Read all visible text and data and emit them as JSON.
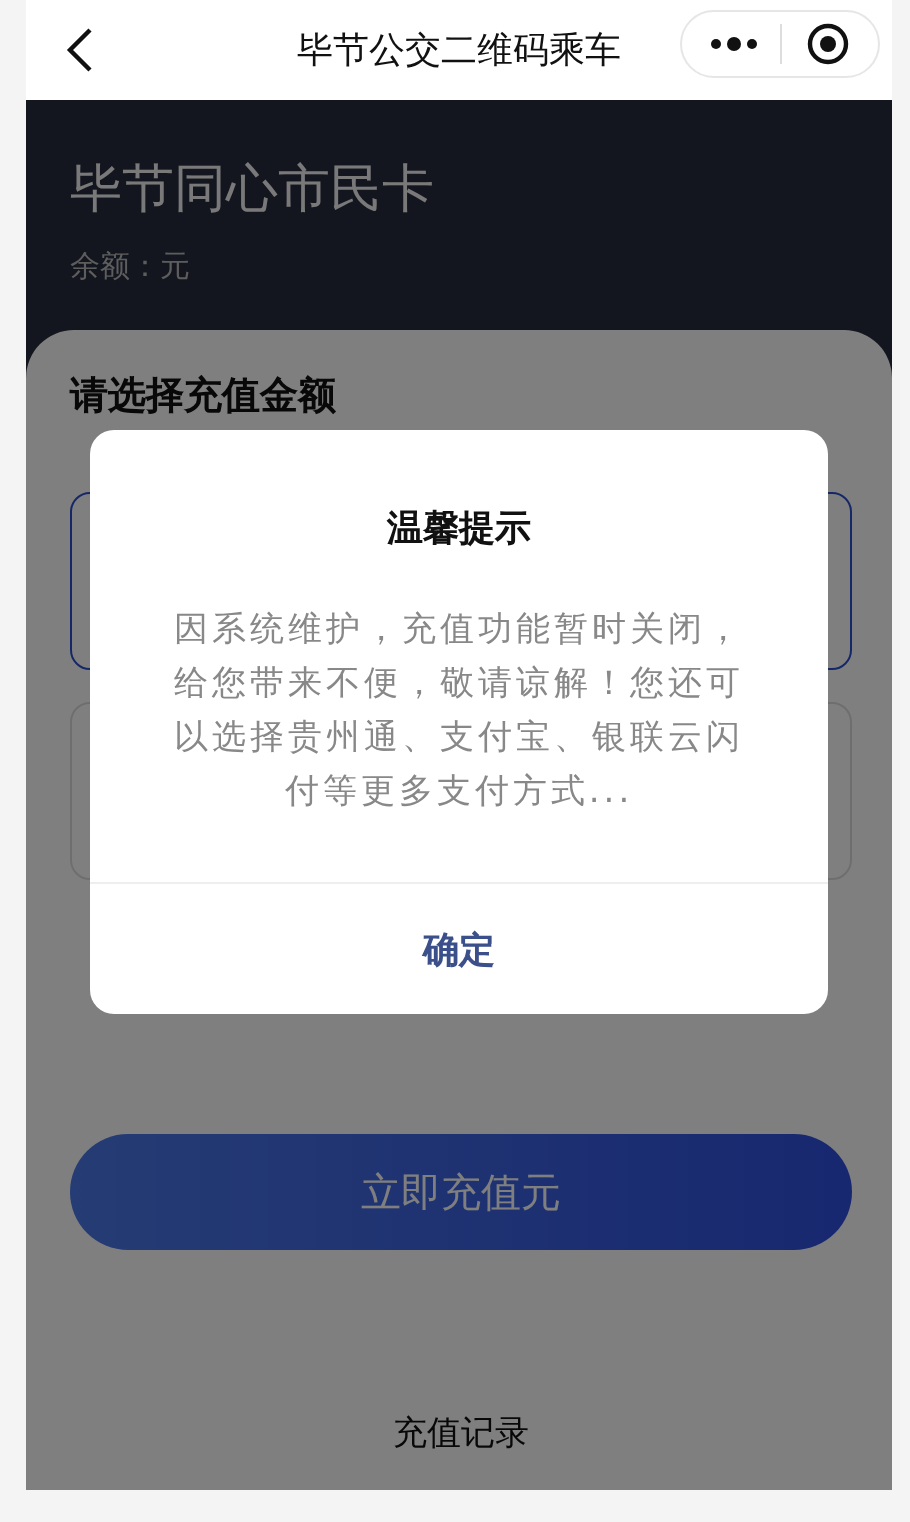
{
  "nav": {
    "title": "毕节公交二维码乘车"
  },
  "card": {
    "name": "毕节同心市民卡",
    "balance": "余额：元"
  },
  "recharge": {
    "heading": "请选择充值金额",
    "amount_options": [
      {
        "selected": true
      },
      {
        "selected": false
      }
    ],
    "submit": "立即充值元",
    "history_link": "充值记录"
  },
  "dialog": {
    "title": "温馨提示",
    "message": "因系统维护，充值功能暂时关闭，给您带来不便，敬请谅解！您还可以选择贵州通、支付宝、银联云闪付等更多支付方式...",
    "confirm": "确定"
  }
}
